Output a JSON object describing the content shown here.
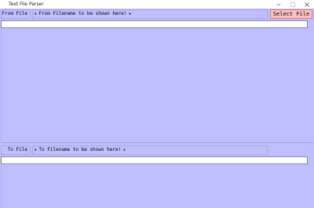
{
  "window": {
    "title": "Text File Parser"
  },
  "source": {
    "label": "From File",
    "filename_placeholder": "From Filename to be shown here!",
    "select_button_label": "Select File",
    "entry_value": ""
  },
  "target": {
    "label": "To File",
    "filename_placeholder": "To Filename to be shown here!",
    "entry_value": ""
  },
  "icons": {
    "app": "feather-icon",
    "minimize": "minimize-icon",
    "maximize": "maximize-icon",
    "close": "close-icon",
    "dropdown": "triangle-down-icon"
  },
  "colors": {
    "background": "#bfbfff",
    "select_button": "#ffc0c0",
    "entry_background": "#ffffff"
  }
}
